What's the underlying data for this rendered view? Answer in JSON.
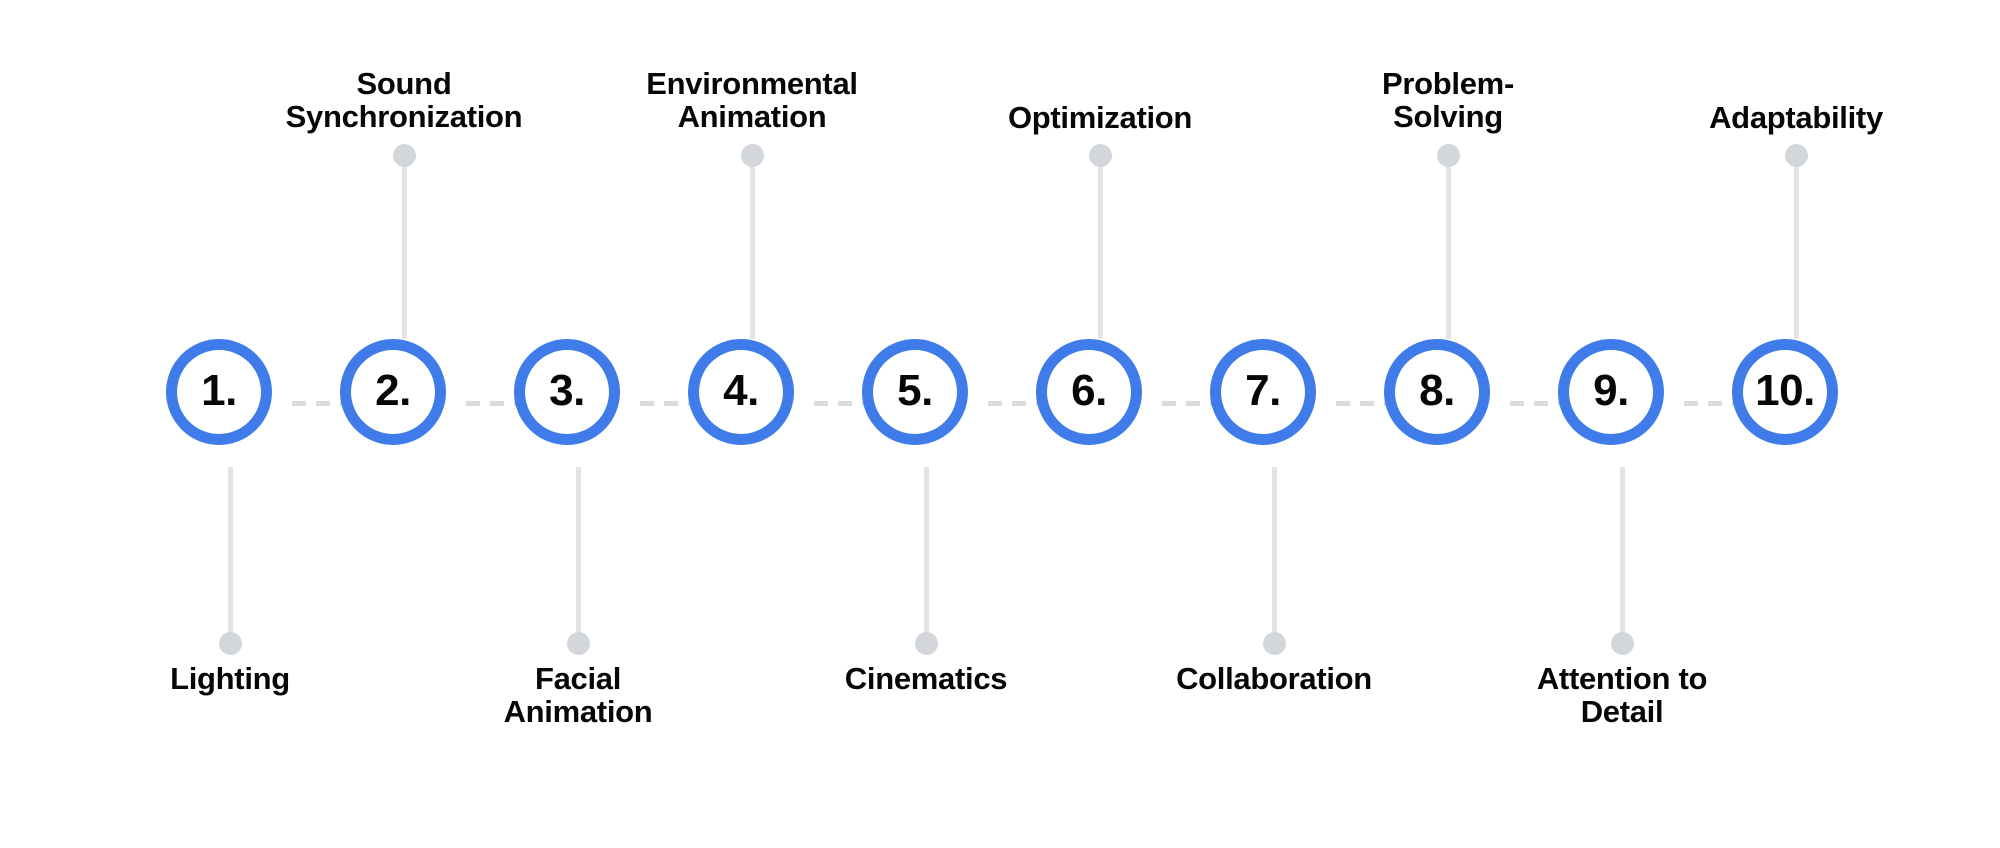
{
  "title": "Numbered Skills Timeline",
  "theme": {
    "accent": "#3f7cea",
    "text": "#070707",
    "connector": "#e2e4e7",
    "dot": "#d3d6db",
    "dash": "#d9dbdf",
    "background": "#ffffff"
  },
  "timeline": {
    "orientation": "horizontal",
    "node_count": 10,
    "steps": [
      {
        "number": "1.",
        "label": "Lighting",
        "side": "bottom",
        "label_lines": 1
      },
      {
        "number": "2.",
        "label": "Sound\nSynchronization",
        "side": "top",
        "label_lines": 2
      },
      {
        "number": "3.",
        "label": "Facial\nAnimation",
        "side": "bottom",
        "label_lines": 2
      },
      {
        "number": "4.",
        "label": "Environmental\nAnimation",
        "side": "top",
        "label_lines": 2
      },
      {
        "number": "5.",
        "label": "Cinematics",
        "side": "bottom",
        "label_lines": 1
      },
      {
        "number": "6.",
        "label": "Optimization",
        "side": "top",
        "label_lines": 1
      },
      {
        "number": "7.",
        "label": "Collaboration",
        "side": "bottom",
        "label_lines": 1
      },
      {
        "number": "8.",
        "label": "Problem-\nSolving",
        "side": "top",
        "label_lines": 2
      },
      {
        "number": "9.",
        "label": "Attention to\nDetail",
        "side": "bottom",
        "label_lines": 2
      },
      {
        "number": "10.",
        "label": "Adaptability",
        "side": "top",
        "label_lines": 1
      }
    ]
  }
}
